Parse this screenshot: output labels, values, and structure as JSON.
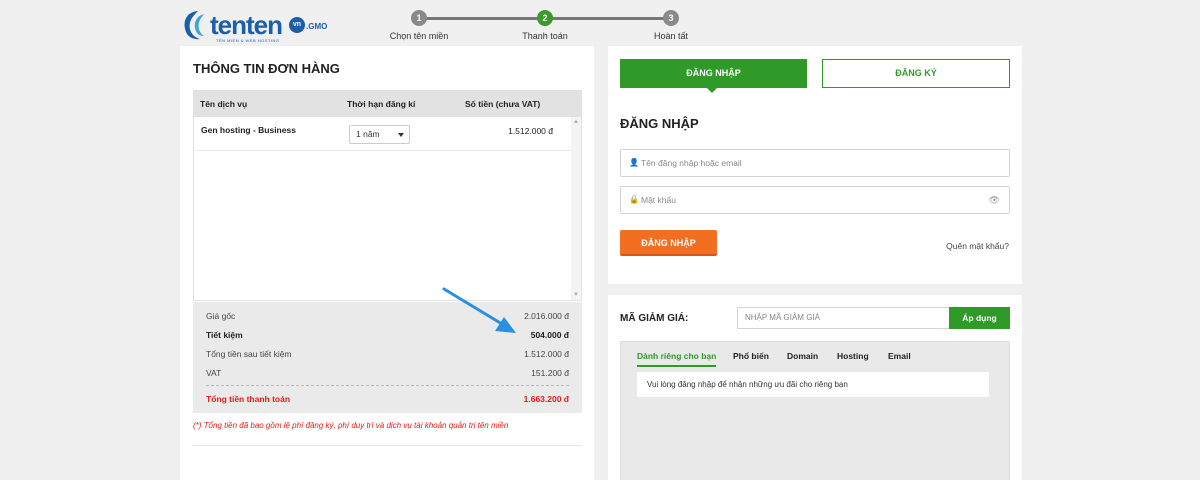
{
  "header": {
    "logo": {
      "main": "tenten",
      "badge": "vn",
      "suffix": ".GMO",
      "tagline": "TÊN MIỀN & WEB HOSTING"
    },
    "steps": [
      {
        "number": "1",
        "label": "Chọn tên miền",
        "state": "done"
      },
      {
        "number": "2",
        "label": "Thanh toán",
        "state": "active"
      },
      {
        "number": "3",
        "label": "Hoàn tất",
        "state": "pending"
      }
    ]
  },
  "order": {
    "title": "THÔNG TIN ĐƠN HÀNG",
    "columns": [
      "Tên dịch vụ",
      "Thời hạn đăng kí",
      "Số tiền (chưa VAT)"
    ],
    "items": [
      {
        "service": "Gen hosting - Business",
        "term": "1 năm",
        "price": "1.512.000 đ"
      }
    ],
    "summary": {
      "original_label": "Giá gốc",
      "original_value": "2.016.000 đ",
      "saving_label": "Tiết kiệm",
      "saving_value": "504.000 đ",
      "after_saving_label": "Tổng tiền sau tiết kiệm",
      "after_saving_value": "1.512.000 đ",
      "vat_label": "VAT",
      "vat_value": "151.200 đ",
      "total_label": "Tổng tiền thanh toán",
      "total_value": "1.663.200 đ"
    },
    "note": "(*) Tổng tiền đã bao gồm lệ phí đăng ký, phí duy trì và dịch vụ tài khoản quản trị tên miền"
  },
  "login": {
    "tab_login": "ĐĂNG NHẬP",
    "tab_register": "ĐĂNG KÝ",
    "heading": "ĐĂNG NHẬP",
    "username_placeholder": "Tên đăng nhập hoặc email",
    "password_placeholder": "Mật khẩu",
    "submit": "ĐĂNG NHẬP",
    "forgot": "Quên mật khẩu?"
  },
  "discount": {
    "label": "MÃ GIẢM GIÁ:",
    "input_placeholder": "NHẬP MÃ GIẢM GIÁ",
    "apply": "Áp dụng",
    "tabs": [
      "Dành riêng cho bạn",
      "Phổ biến",
      "Domain",
      "Hosting",
      "Email"
    ],
    "message": "Vui lòng đăng nhập để nhận những ưu đãi cho riêng bạn"
  },
  "colors": {
    "green": "#2f9a27",
    "orange": "#f26f21",
    "red": "#e21b1b",
    "brand_blue": "#1b5fa8",
    "arrow_blue": "#2b8fe0"
  },
  "icons": [
    "user-icon",
    "lock-icon",
    "eye-icon",
    "chevron-down-icon",
    "scroll-up-icon",
    "scroll-down-icon",
    "arrow-annotation-icon"
  ]
}
